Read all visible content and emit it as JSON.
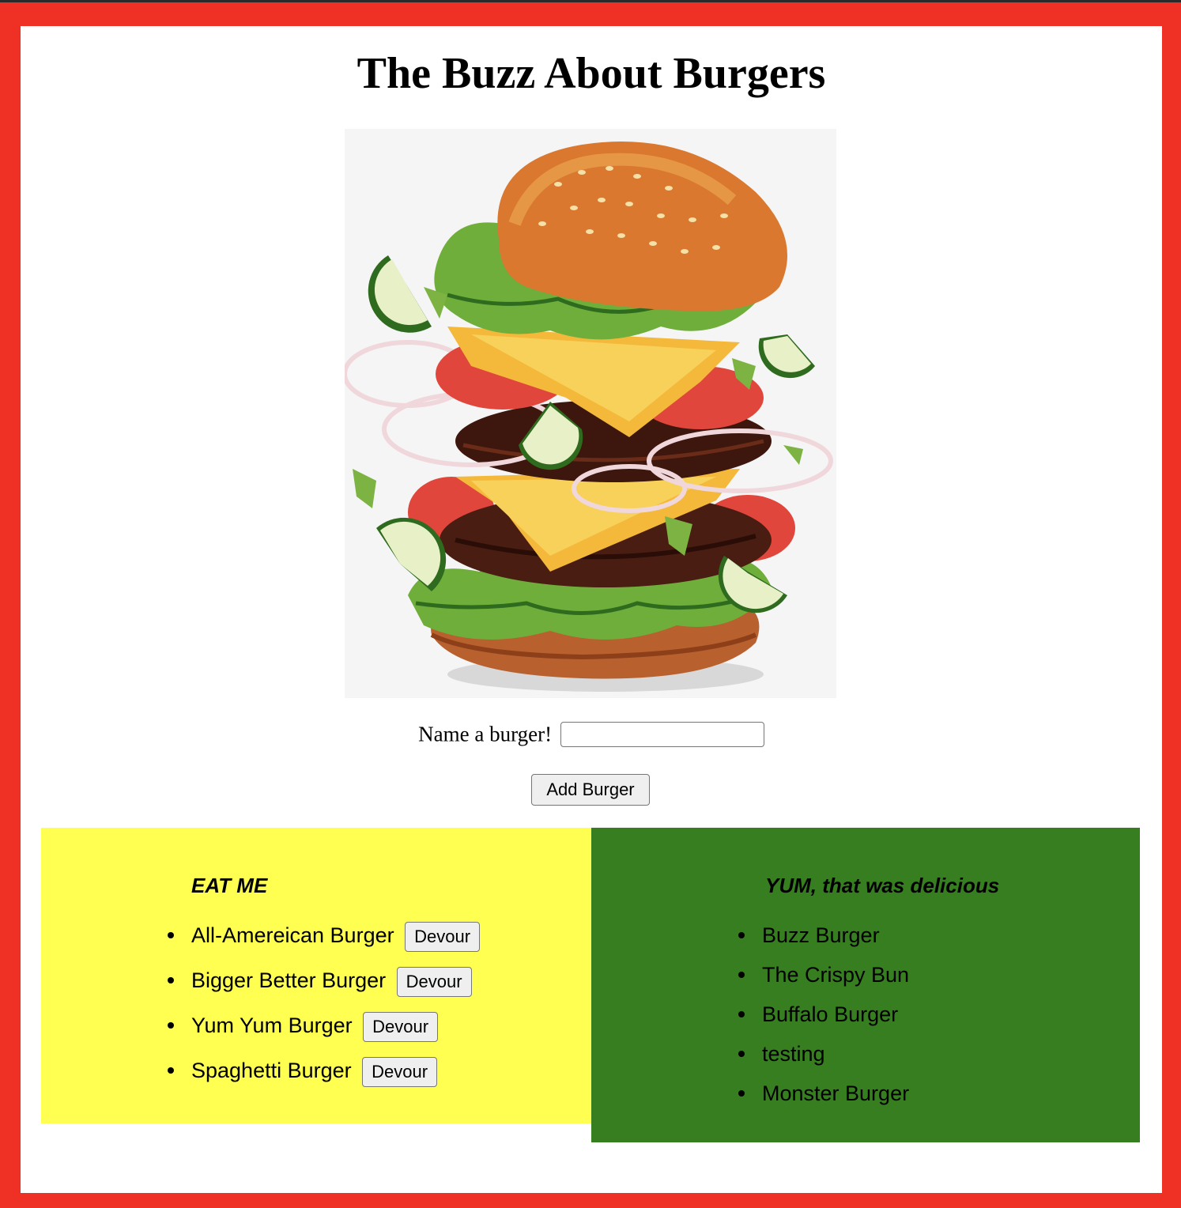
{
  "page": {
    "title": "The Buzz About Burgers",
    "hero_image": "burger-illustration",
    "colors": {
      "frame": "#ee3124",
      "eat_panel": "#ffff52",
      "devoured_panel": "#367e20"
    }
  },
  "form": {
    "label": "Name a burger!",
    "input_value": "",
    "submit_label": "Add Burger"
  },
  "eat_panel": {
    "heading": "EAT ME",
    "items": [
      {
        "name": "All-Amereican Burger",
        "button": "Devour"
      },
      {
        "name": "Bigger Better Burger",
        "button": "Devour"
      },
      {
        "name": "Yum Yum Burger",
        "button": "Devour"
      },
      {
        "name": "Spaghetti Burger",
        "button": "Devour"
      }
    ]
  },
  "devoured_panel": {
    "heading": "YUM, that was delicious",
    "items": [
      {
        "name": "Buzz Burger"
      },
      {
        "name": "The Crispy Bun"
      },
      {
        "name": "Buffalo Burger"
      },
      {
        "name": "testing"
      },
      {
        "name": "Monster Burger"
      }
    ]
  }
}
